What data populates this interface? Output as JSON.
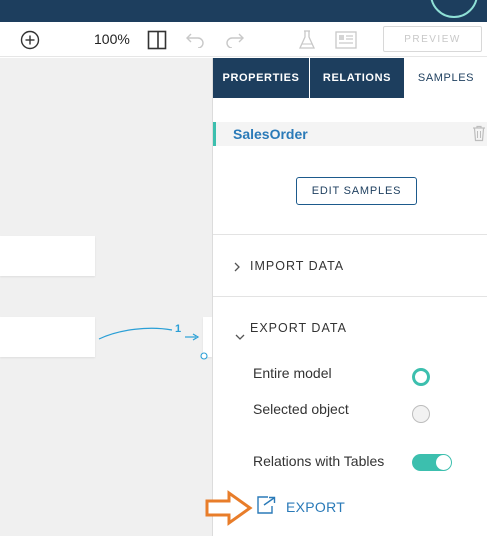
{
  "toolbar": {
    "zoom": "100%",
    "preview_label": "PREVIEW"
  },
  "icons": {
    "add": "circle-plus-icon",
    "panel": "split-panel-icon",
    "undo": "undo-icon",
    "redo": "redo-icon",
    "test": "flask-icon",
    "data": "form-icon",
    "trash": "trash-icon",
    "export": "export-icon",
    "annotation": "orange-arrow-icon"
  },
  "canvas": {
    "relation_label": "1"
  },
  "panel": {
    "tabs": [
      "PROPERTIES",
      "RELATIONS",
      "SAMPLES"
    ],
    "entity_name": "SalesOrder",
    "edit_samples_label": "EDIT SAMPLES",
    "import_data_label": "IMPORT DATA",
    "export_data_label": "EXPORT DATA",
    "options": {
      "entire_model": "Entire model",
      "selected_object": "Selected object",
      "relations_with_tables": "Relations with Tables"
    },
    "export_label": "EXPORT"
  },
  "state": {
    "selected_option": "Entire model",
    "relations_with_tables": true
  },
  "colors": {
    "navy": "#1d3e5e",
    "teal": "#3cbfae",
    "link_blue": "#2a7ab8",
    "annotation_orange": "#e87d2a"
  }
}
